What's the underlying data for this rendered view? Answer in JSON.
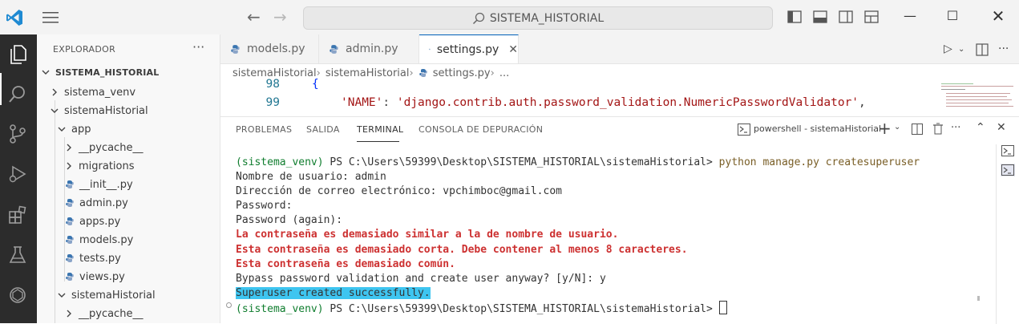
{
  "titlebar": {
    "search_text": "SISTEMA_HISTORIAL"
  },
  "sidebar": {
    "header": "EXPLORADOR",
    "more": "···",
    "root": "SISTEMA_HISTORIAL",
    "items": [
      {
        "label": "sistema_venv",
        "kind": "folder-collapsed"
      },
      {
        "label": "sistemaHistorial",
        "kind": "folder-open"
      },
      {
        "label": "app",
        "kind": "folder-open"
      },
      {
        "label": "__pycache__",
        "kind": "folder-collapsed"
      },
      {
        "label": "migrations",
        "kind": "folder-collapsed"
      },
      {
        "label": "__init__.py",
        "kind": "py"
      },
      {
        "label": "admin.py",
        "kind": "py"
      },
      {
        "label": "apps.py",
        "kind": "py"
      },
      {
        "label": "models.py",
        "kind": "py"
      },
      {
        "label": "tests.py",
        "kind": "py"
      },
      {
        "label": "views.py",
        "kind": "py"
      },
      {
        "label": "sistemaHistorial",
        "kind": "folder-open"
      },
      {
        "label": "__pycache__",
        "kind": "folder-collapsed"
      }
    ]
  },
  "editor": {
    "tabs": [
      {
        "label": "models.py",
        "active": false
      },
      {
        "label": "admin.py",
        "active": false
      },
      {
        "label": "settings.py",
        "active": true
      }
    ],
    "breadcrumb": [
      "sistemaHistorial",
      "sistemaHistorial",
      "settings.py",
      "..."
    ],
    "lines": [
      {
        "num": "98",
        "text": "{"
      },
      {
        "num": "99",
        "key": "'NAME'",
        "sep": ": ",
        "value": "'django.contrib.auth.password_validation.NumericPasswordValidator'",
        "tail": ","
      }
    ]
  },
  "panel": {
    "tabs": [
      "PROBLEMAS",
      "SALIDA",
      "TERMINAL",
      "CONSOLA DE DEPURACIÓN"
    ],
    "active_tab": "TERMINAL",
    "terminal_name": "powershell - sistemaHistorial",
    "terminal": {
      "prompt_env": "(sistema_venv)",
      "prompt_path": " PS C:\\Users\\59399\\Desktop\\SISTEMA_HISTORIAL\\sistemaHistorial> ",
      "command": "python manage.py createsuperuser",
      "line_username": "Nombre de usuario: admin",
      "line_email": "Dirección de correo electrónico: vpchimboc@gmail.com",
      "line_password": "Password:",
      "line_password_again": "Password (again):",
      "err1": "La contraseña es demasiado similar a la de nombre de usuario.",
      "err2": "Esta contraseña es demasiado corta. Debe contener al menos 8 caracteres.",
      "err3": "Esta contraseña es demasiado común.",
      "line_bypass": "Bypass password validation and create user anyway? [y/N]: y",
      "line_success": "Superuser created successfully.",
      "prompt2_env": "(sistema_venv)",
      "prompt2_path": " PS C:\\Users\\59399\\Desktop\\SISTEMA_HISTORIAL\\sistemaHistorial> "
    }
  },
  "colors": {
    "accent": "#005fb8",
    "activity_bar": "#2c2c2c",
    "error_text": "#cd3131",
    "venv_text": "#0f7d2e",
    "highlight": "#3ec5f0"
  }
}
